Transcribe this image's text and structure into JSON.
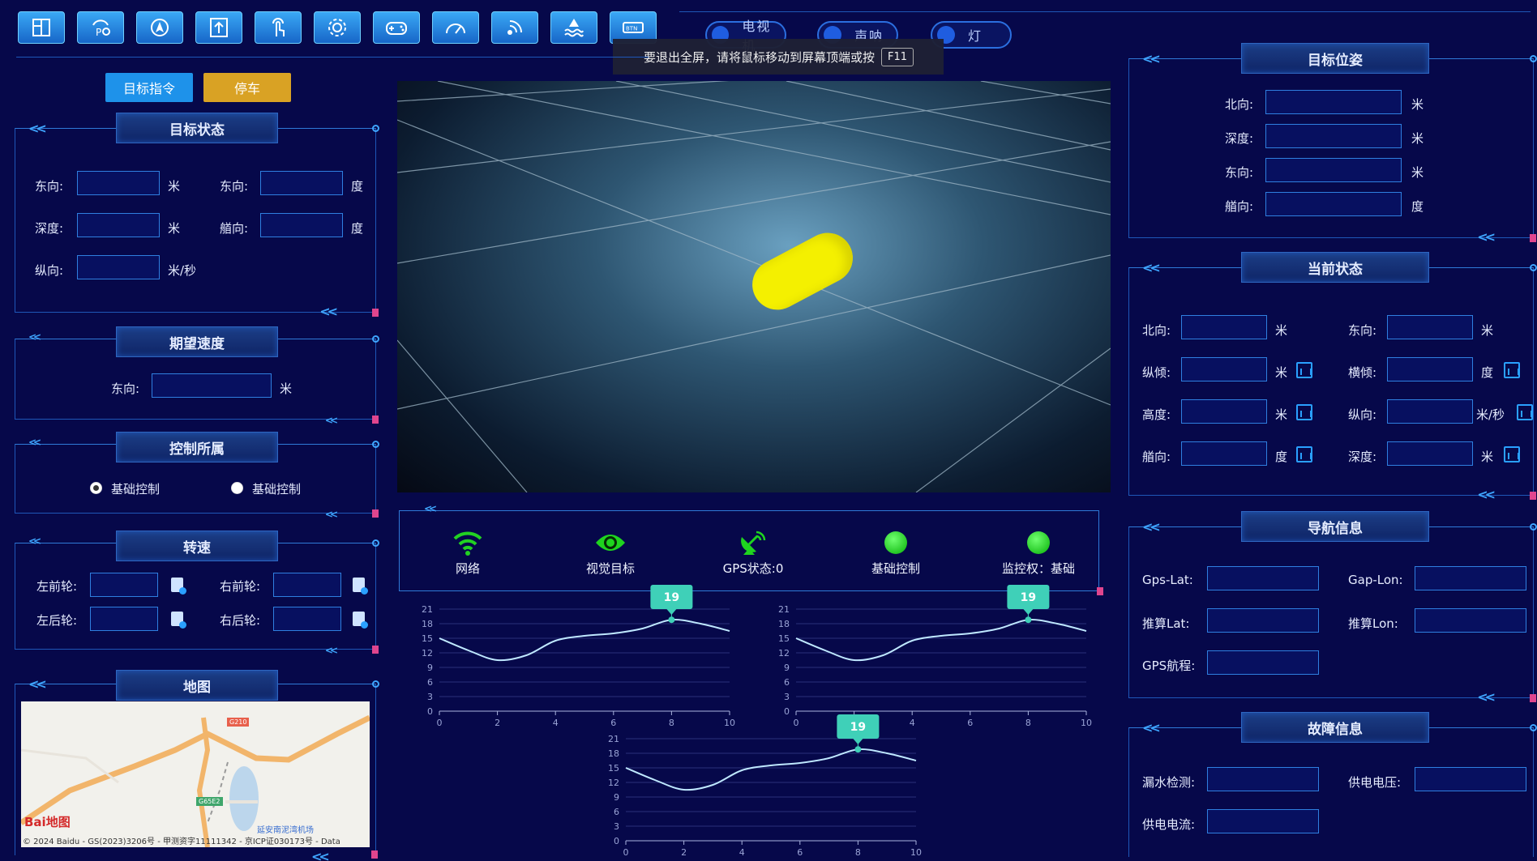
{
  "toolbar": {
    "icons": [
      "layout-icon",
      "parking-assist-icon",
      "navigation-icon",
      "upload-icon",
      "touch-icon",
      "settings-icon",
      "gamepad-icon",
      "speedometer-icon",
      "signal-icon",
      "water-icon",
      "btn-icon"
    ],
    "toggles": [
      "电视机",
      "声呐",
      "灯"
    ]
  },
  "fullscreen_toast": {
    "text": "要退出全屏，请将鼠标移动到屏幕顶端或按",
    "key": "F11"
  },
  "actions": {
    "target_cmd": "目标指令",
    "stop": "停车"
  },
  "target_state": {
    "title": "目标状态",
    "east_label": "东向:",
    "east_unit": "米",
    "east2_label": "东向:",
    "east2_unit": "度",
    "depth_label": "深度:",
    "depth_unit": "米",
    "heading_label": "艏向:",
    "heading_unit": "度",
    "long_label": "纵向:",
    "long_unit": "米/秒"
  },
  "desired_speed": {
    "title": "期望速度",
    "east_label": "东向:",
    "east_unit": "米"
  },
  "control_owner": {
    "title": "控制所属",
    "opt1": "基础控制",
    "opt2": "基础控制"
  },
  "rpm": {
    "title": "转速",
    "lf": "左前轮:",
    "rf": "右前轮:",
    "lr": "左后轮:",
    "rr": "右后轮:"
  },
  "map": {
    "title": "地图",
    "road1": "G210",
    "road2": "G65E2",
    "poi": "延安南泥湾机场",
    "logo": "Bai地图",
    "copyright": "© 2024 Baidu - GS(2023)3206号 - 甲测资字11111342 - 京ICP证030173号 - Data"
  },
  "status": {
    "network": "网络",
    "vision": "视觉目标",
    "gps": "GPS状态:0",
    "basic": "基础控制",
    "monitor": "监控权：基础"
  },
  "target_pose": {
    "title": "目标位姿",
    "north": "北向:",
    "north_unit": "米",
    "depth": "深度:",
    "depth_unit": "米",
    "east": "东向:",
    "east_unit": "米",
    "heading": "艏向:",
    "heading_unit": "度"
  },
  "current_state": {
    "title": "当前状态",
    "north": "北向:",
    "north_unit": "米",
    "east": "东向:",
    "east_unit": "米",
    "pitch": "纵倾:",
    "pitch_unit": "米",
    "roll": "横倾:",
    "roll_unit": "度",
    "height": "高度:",
    "height_unit": "米",
    "long": "纵向:",
    "long_unit": "米/秒",
    "heading": "艏向:",
    "heading_unit": "度",
    "depth": "深度:",
    "depth_unit": "米"
  },
  "nav_info": {
    "title": "导航信息",
    "gps_lat": "Gps-Lat:",
    "gap_lon": "Gap-Lon:",
    "calc_lat": "推算Lat:",
    "calc_lon": "推算Lon:",
    "gps_course": "GPS航程:"
  },
  "fault_info": {
    "title": "故障信息",
    "leak": "漏水检测:",
    "voltage": "供电电压:",
    "current": "供电电流:"
  },
  "chart_data": [
    {
      "type": "line",
      "x": [
        0,
        1,
        2,
        3,
        4,
        5,
        6,
        7,
        8,
        9,
        10
      ],
      "y": [
        15,
        12.5,
        10.5,
        11.5,
        14.5,
        15.5,
        16,
        17,
        18.8,
        18,
        16.5
      ],
      "xlim": [
        0,
        10
      ],
      "ylim": [
        0,
        21
      ],
      "yticks": [
        0,
        3,
        6,
        9,
        12,
        15,
        18,
        21
      ],
      "xticks": [
        0,
        2,
        4,
        6,
        8,
        10
      ],
      "tooltip": {
        "x": 8,
        "label": "19"
      }
    },
    {
      "type": "line",
      "x": [
        0,
        1,
        2,
        3,
        4,
        5,
        6,
        7,
        8,
        9,
        10
      ],
      "y": [
        15,
        12.5,
        10.5,
        11.5,
        14.5,
        15.5,
        16,
        17,
        18.8,
        18,
        16.5
      ],
      "xlim": [
        0,
        10
      ],
      "ylim": [
        0,
        21
      ],
      "yticks": [
        0,
        3,
        6,
        9,
        12,
        15,
        18,
        21
      ],
      "xticks": [
        0,
        2,
        4,
        6,
        8,
        10
      ],
      "tooltip": {
        "x": 8,
        "label": "19"
      }
    },
    {
      "type": "line",
      "x": [
        0,
        1,
        2,
        3,
        4,
        5,
        6,
        7,
        8,
        9,
        10
      ],
      "y": [
        15,
        12.5,
        10.5,
        11.5,
        14.5,
        15.5,
        16,
        17,
        18.8,
        18,
        16.5
      ],
      "xlim": [
        0,
        10
      ],
      "ylim": [
        0,
        21
      ],
      "yticks": [
        0,
        3,
        6,
        9,
        12,
        15,
        18,
        21
      ],
      "xticks": [
        0,
        2,
        4,
        6,
        8,
        10
      ],
      "tooltip": {
        "x": 8,
        "label": "19"
      }
    }
  ]
}
